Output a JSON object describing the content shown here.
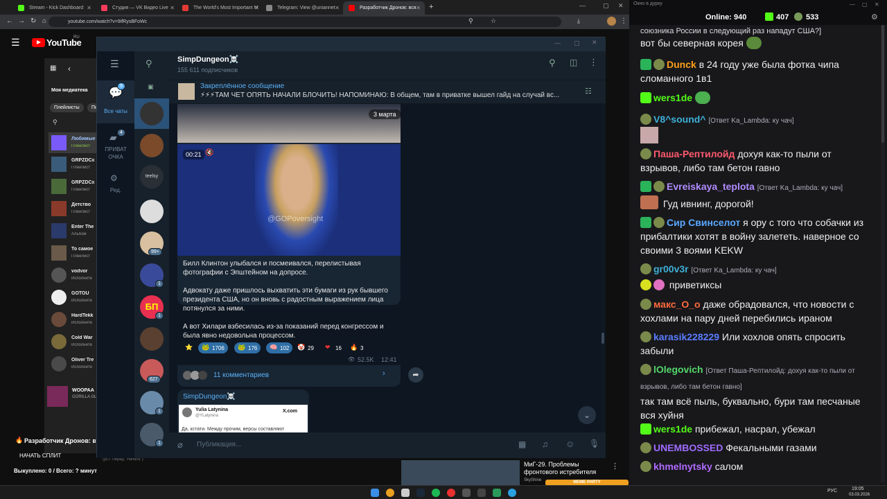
{
  "browser": {
    "tabs": [
      {
        "label": "Stream - Kick Dashboard",
        "color": "#53fc18"
      },
      {
        "label": "Студия — VK Видео Live",
        "color": "#ff3b5c"
      },
      {
        "label": "The World's Most Important M",
        "color": "#e53935"
      },
      {
        "label": "Telegram: View @uniannet",
        "color": "#888888"
      },
      {
        "label": "Разработчик Дронов: вся",
        "color": "#ff0000"
      }
    ],
    "url": "youtube.com/watch?v=9ifRysBFoWc"
  },
  "youtube": {
    "logo": "YouTube",
    "region": "RU",
    "library_title": "Моя медиатека",
    "filter_playlists": "Плейлисты",
    "filter_next": "По",
    "items": [
      {
        "title": "Любимые",
        "sub": "Плейлист"
      },
      {
        "title": "GRPZDCx",
        "sub": "Плейлист"
      },
      {
        "title": "GRPZDCx",
        "sub": "Плейлист"
      },
      {
        "title": "Детство",
        "sub": "Плейлист"
      },
      {
        "title": "Enter The",
        "sub": "Альбом"
      },
      {
        "title": "То самое",
        "sub": "Плейлист"
      },
      {
        "title": "vodvor",
        "sub": "Исполните"
      },
      {
        "title": "GOTOU",
        "sub": "Исполните"
      },
      {
        "title": "HardTekk",
        "sub": "Исполните"
      },
      {
        "title": "Cold War",
        "sub": "Исполните"
      },
      {
        "title": "Oliver Tre",
        "sub": "Исполните"
      }
    ],
    "now_playing_title": "WOOPAA",
    "now_playing_sub": "GORILLA GL",
    "video_title": "Разработчик Дронов: вся",
    "split_button": "НАЧАТЬ СПЛИТ",
    "purchased": "Выкуплено: 0 / Всего: ? минут",
    "last_order": "(уст. Перед \"Начать\")",
    "rec_title": "МиГ-29. Проблемы фронтового истребителя",
    "rec_channel": "SkyShine",
    "meme_label": "MEME PARTY"
  },
  "telegram": {
    "left_nav": [
      {
        "label": "Все чаты",
        "count": "9"
      },
      {
        "label": "ПРИВАТ ОЧКА",
        "count": "4"
      },
      {
        "label": "Ред."
      }
    ],
    "chat_badges": [
      "99+",
      "1",
      "1",
      "627",
      "1",
      "1"
    ],
    "chat_list_text": "teelsy",
    "channel_name": "SimpDungeon☠️",
    "subscribers": "155 611 подписчиков",
    "pinned_title": "Закреплённое сообщение",
    "pinned_text": "⚡⚡⚡ТАМ ЧЕТ ОПЯТЬ НАЧАЛИ БЛОЧИТЬ! НАПОМИНАЮ:  В общем, там в приватке вышел гайд на случай вс...",
    "date_badge": "3 марта",
    "video_time": "00:21",
    "watermark": "@GOPoversight",
    "post_paragraphs": [
      "Билл Клинтон улыбался и посмеивался, перелистывая фотографии с Эпштейном на допросе.",
      "Адвокату даже пришлось выхватить эти бумаги из рук бывшего президента США, но он вновь с радостным выражением лица потянулся за ними.",
      "А вот Хилари взбесилась из-за показаний перед конгрессом и была явно недовольна процессом."
    ],
    "reactions": [
      {
        "emoji": "⭐",
        "count": ""
      },
      {
        "emoji": "🐸",
        "count": "1706"
      },
      {
        "emoji": "🐸",
        "count": "176"
      },
      {
        "emoji": "🧠",
        "count": "102"
      },
      {
        "emoji": "🤡",
        "count": "29"
      },
      {
        "emoji": "❤",
        "count": "16"
      },
      {
        "emoji": "🔥",
        "count": "3"
      }
    ],
    "views": "52.5K",
    "time": "12:41",
    "comments": "11 комментариев",
    "next_author": "SimpDungeon☠️",
    "embed_name": "Yulia Latynina",
    "embed_handle": "@YLatynina",
    "embed_source": "X.com",
    "embed_text": "Да, кстати. Между прочим, версы составляют",
    "input_placeholder": "Публикация..."
  },
  "chat": {
    "window_title": "Окно в дурку",
    "online_label": "Online:",
    "online": "940",
    "kick_count": "407",
    "other_count": "533",
    "messages": [
      {
        "user": "",
        "color": "#efeff1",
        "reply": "",
        "text": "союзника России в следующий раз нападут США?]"
      },
      {
        "user": "",
        "color": "#efeff1",
        "reply": "",
        "text": "вот бы северная корея"
      },
      {
        "user": "Dunck",
        "color": "#ff9f1a",
        "reply": "",
        "text": "в 24 году уже была фотка чипа сломанного 1в1"
      },
      {
        "user": "wers1de",
        "color": "#53fc18",
        "reply": "",
        "text": ""
      },
      {
        "user": "V8^sound^",
        "color": "#3fb0d8",
        "reply": "[Ответ Ka_Lambda: ку чач]",
        "text": ""
      },
      {
        "user": "Паша-Рептилойд",
        "color": "#ff5a6e",
        "reply": "",
        "text": "дохуя как-то пыли от взрывов, либо там бетон гавно"
      },
      {
        "user": "Evreiskaya_teplota",
        "color": "#b18cff",
        "reply": "[Ответ Ka_Lambda: ку чач]",
        "text": "Гуд ивнинг, дорогой!"
      },
      {
        "user": "Сир Свинселот",
        "color": "#5aa8ff",
        "reply": "",
        "text": "я ору с того что собачки из прибалтики хотят в войну залететь. наверное со своими 3 воями KEKW"
      },
      {
        "user": "gr00v3r",
        "color": "#3fb0d8",
        "reply": "[Ответ Ka_Lambda: ку чач]",
        "text": "приветиксы"
      },
      {
        "user": "макс_О_о",
        "color": "#ff6a3d",
        "reply": "",
        "text": "даже обрадовался, что новости с хохлами на пару дней перебились ираном"
      },
      {
        "user": "karasik228229",
        "color": "#5a7dff",
        "reply": "",
        "text": "Или хохлов опять спросить забыли"
      },
      {
        "user": "lOlegovich",
        "color": "#53d86a",
        "reply": "[Ответ Паша-Рептилойд: дохуя как-то пыли от взрывов, либо там бетон гавно]",
        "text": "так там всё пыль, буквально, бури там песчаные вся хуйня"
      },
      {
        "user": "wers1de",
        "color": "#53fc18",
        "reply": "",
        "text": "прибежал, насрал, убежал"
      },
      {
        "user": "UNEMBOSSED",
        "color": "#a06bff",
        "reply": "",
        "text": "Фекальными газами"
      },
      {
        "user": "khmelnytsky",
        "color": "#b06bff",
        "reply": "",
        "text": "салом"
      }
    ]
  },
  "taskbar": {
    "lang": "РУС",
    "time": "19:05",
    "date": "03.03.2026"
  }
}
